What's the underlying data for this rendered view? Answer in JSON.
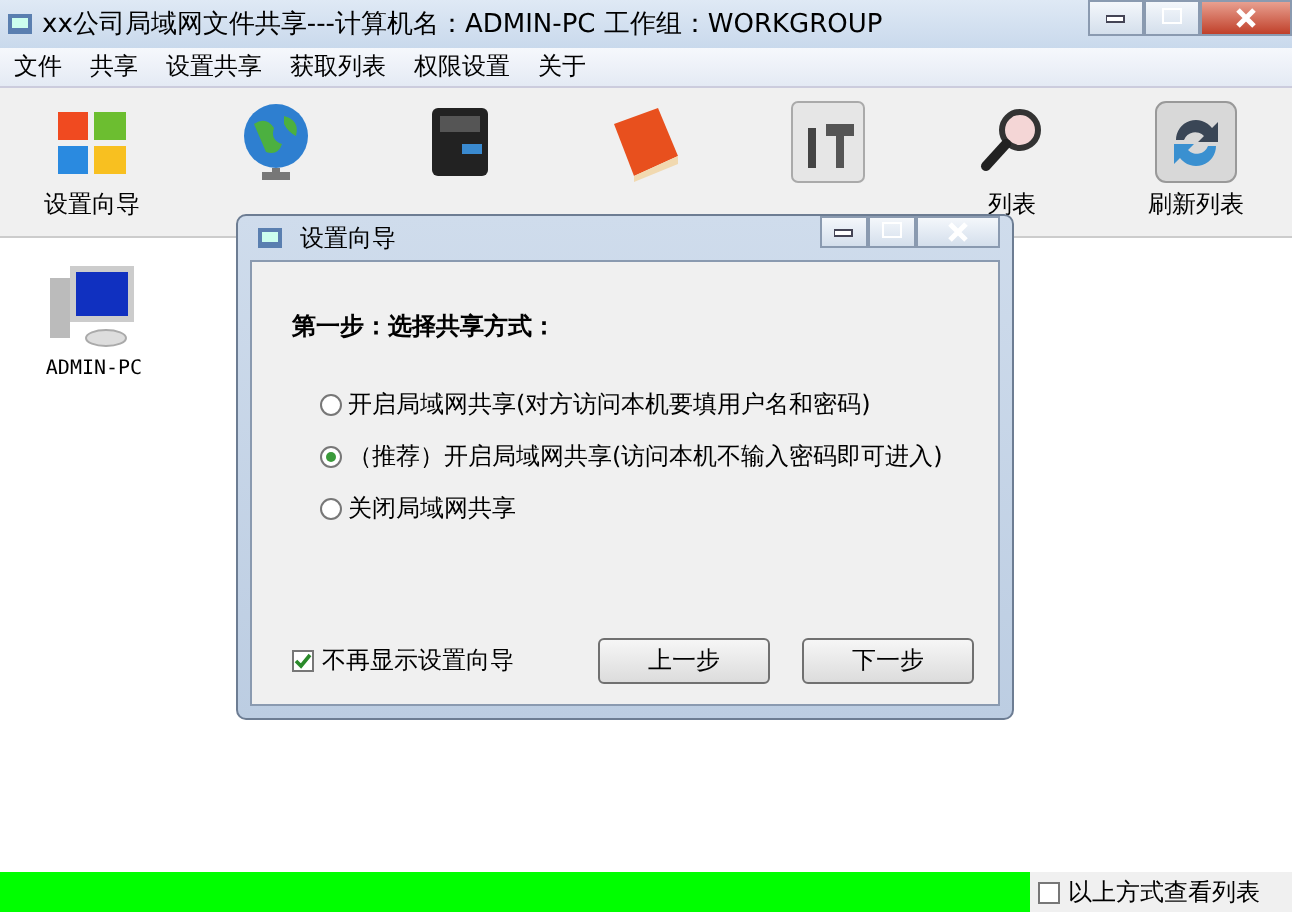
{
  "window": {
    "title": "xx公司局域网文件共享---计算机名：ADMIN-PC  工作组：WORKGROUP"
  },
  "menu": [
    "文件",
    "共享",
    "设置共享",
    "获取列表",
    "权限设置",
    "关于"
  ],
  "toolbar": [
    {
      "kind": "windows",
      "label": "设置向导"
    },
    {
      "kind": "globe"
    },
    {
      "kind": "printer"
    },
    {
      "kind": "book"
    },
    {
      "kind": "tools"
    },
    {
      "kind": "search",
      "label": "列表"
    },
    {
      "kind": "refresh",
      "label": "刷新列表"
    }
  ],
  "computers": [
    {
      "name": "ADMIN-PC"
    }
  ],
  "dialog": {
    "title": "设置向导",
    "heading": "第一步：选择共享方式：",
    "options": [
      {
        "label": "开启局域网共享(对方访问本机要填用户名和密码)",
        "selected": false
      },
      {
        "label": "（推荐）开启局域网共享(访问本机不输入密码即可进入)",
        "selected": true
      },
      {
        "label": "关闭局域网共享",
        "selected": false
      }
    ],
    "dont_show": {
      "label": "不再显示设置向导",
      "checked": true
    },
    "buttons": [
      "上一步",
      "下一步"
    ]
  },
  "status_bar": {
    "progress": {
      "level": 1
    },
    "view_option": {
      "label": "以上方式查看列表",
      "checked": false
    }
  }
}
